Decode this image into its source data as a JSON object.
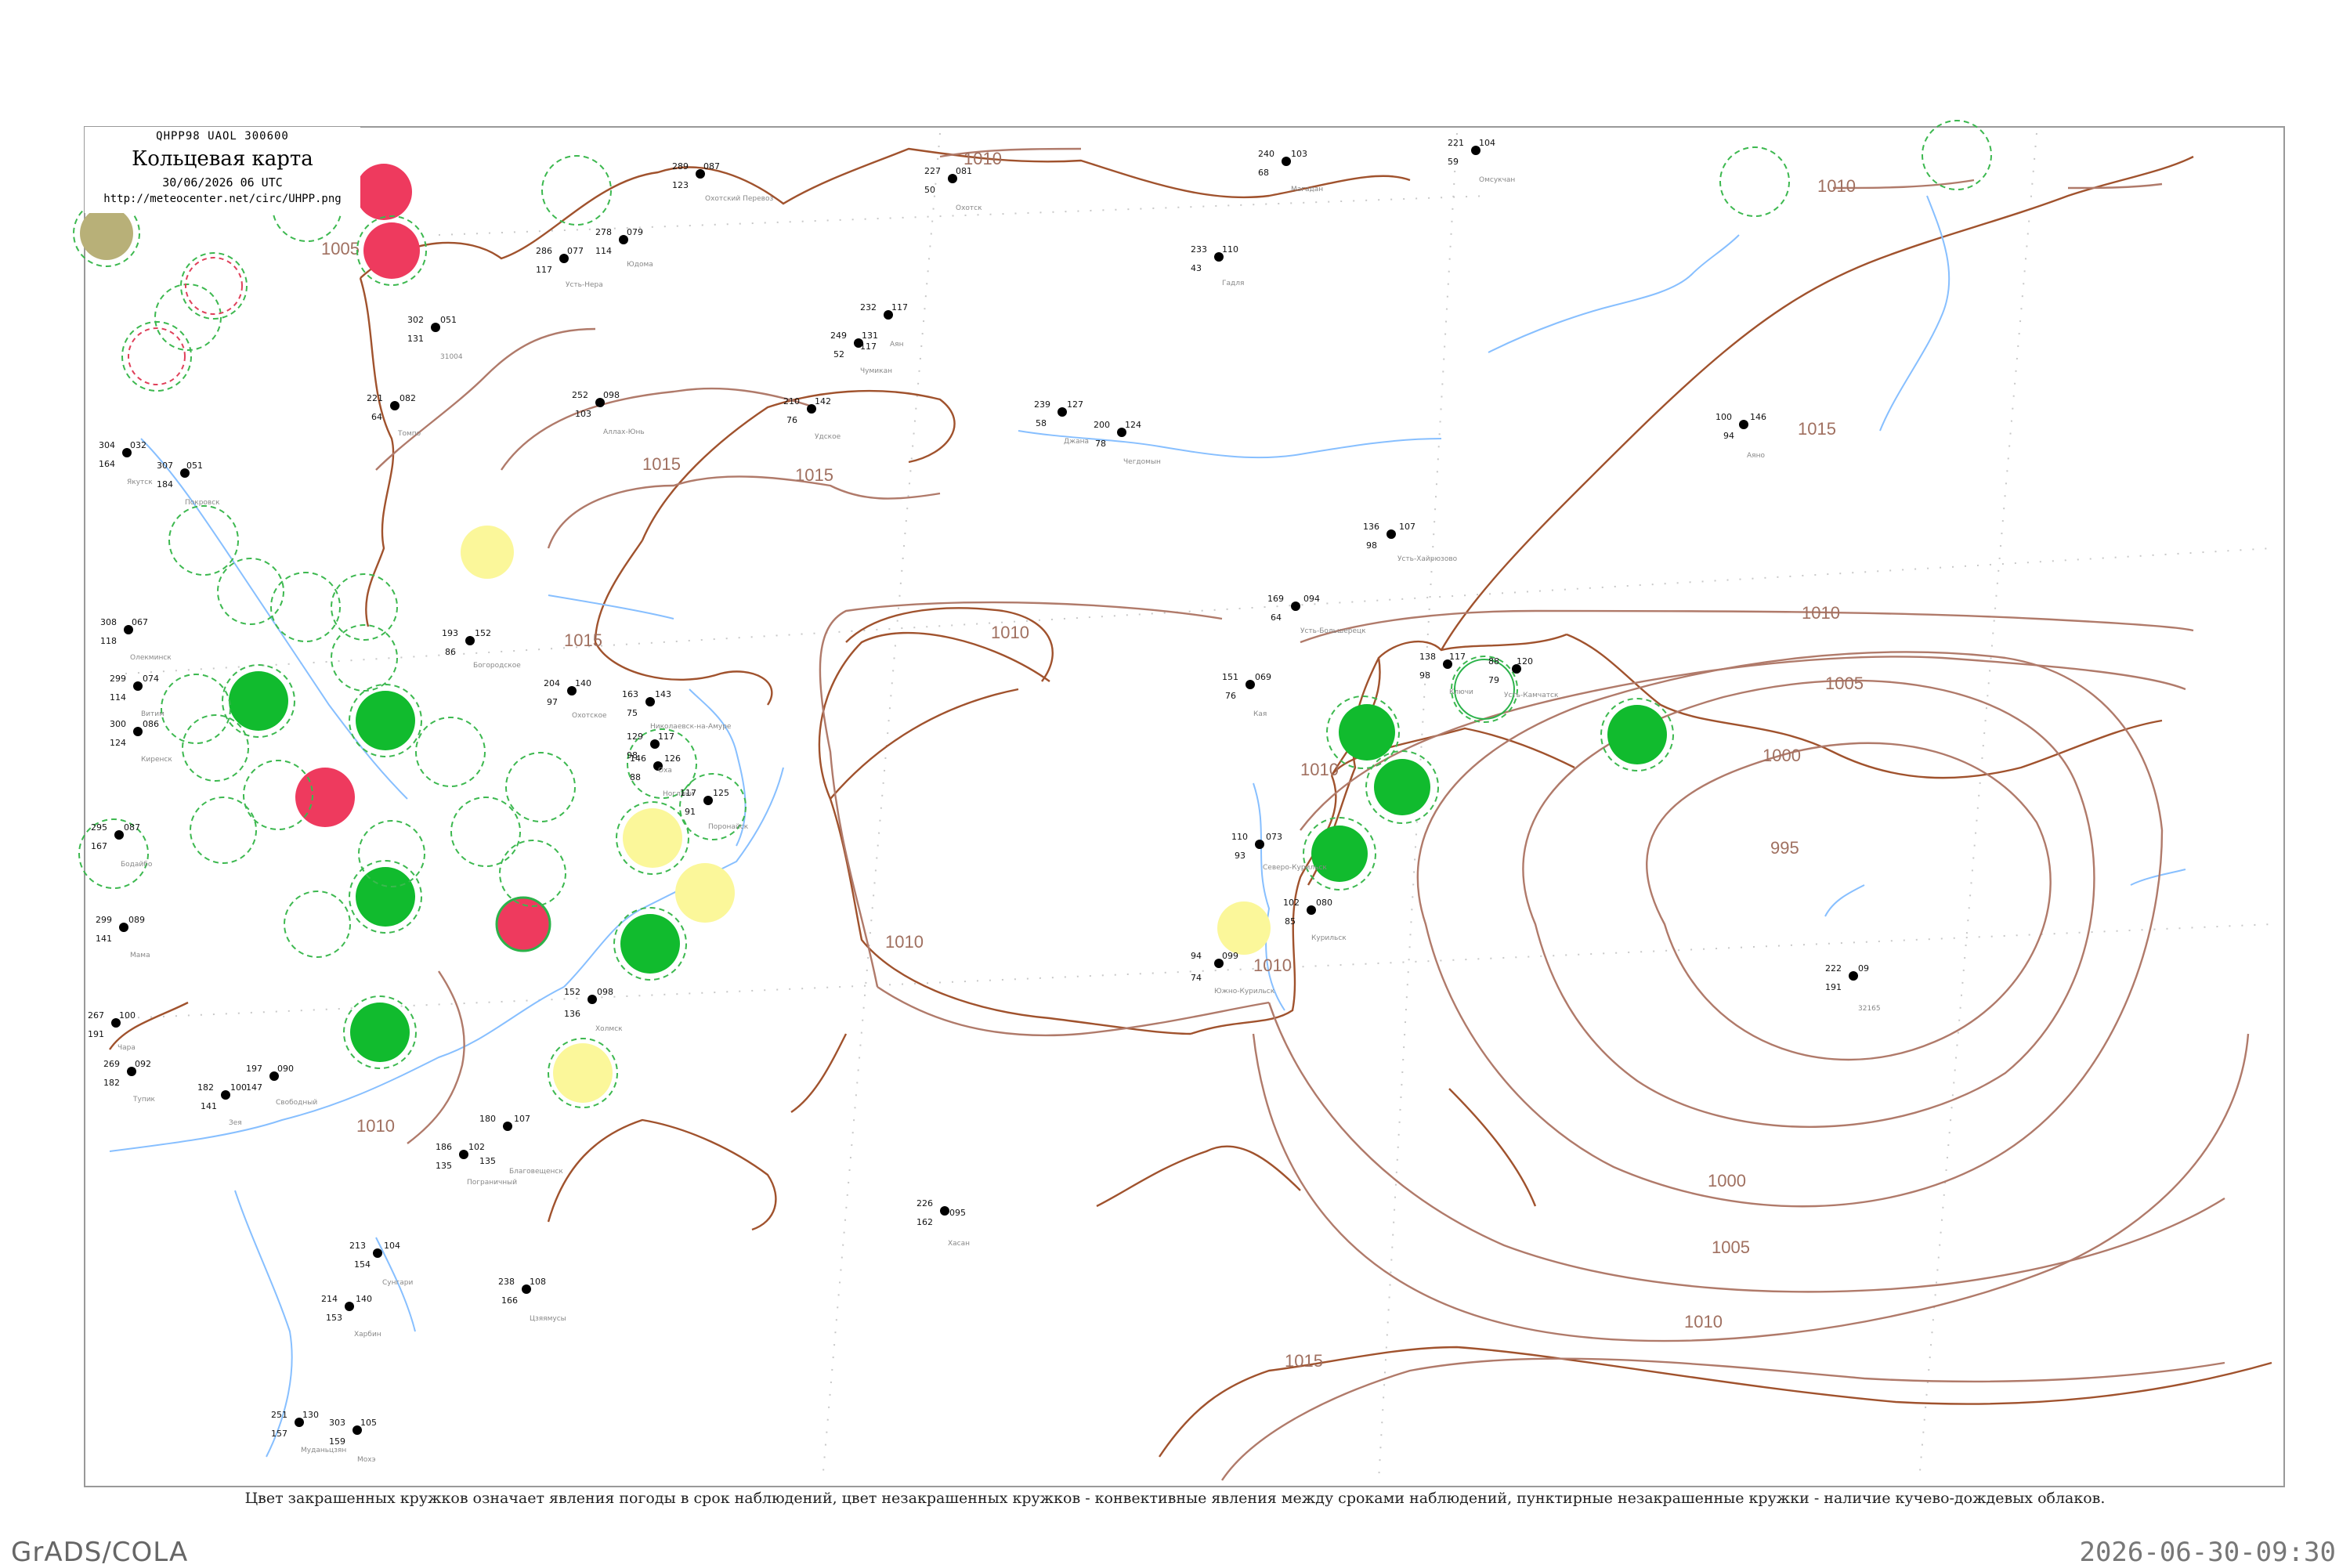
{
  "header": {
    "code": "QHPP98  UAOL  300600",
    "title": "Кольцевая карта",
    "time": "30/06/2026 06 UTC",
    "url": "http://meteocenter.net/circ/UHPP.png"
  },
  "legend": "Цвет закрашенных кружков означает явления погоды в срок наблюдений, цвет незакрашенных кружков - конвективные явления между сроками наблюдений, пунктирные незакрашенные кружки - наличие кучево-дождевых облаков.",
  "footer": {
    "left": "GrADS/COLA",
    "right": "2026-06-30-09:30"
  },
  "colors": {
    "coast": "#a0522d",
    "river": "#87bfff",
    "isobar": "#b07a6a",
    "green": "#11bb2e",
    "red": "#ee3a5e",
    "yellow": "#fbf79a",
    "olive": "#b8b078"
  },
  "isobar_labels": [
    "1010",
    "1015",
    "1010",
    "1015",
    "1010",
    "1005",
    "1000",
    "995",
    "1000",
    "1005",
    "1010",
    "1015",
    "1010",
    "1015",
    "1010",
    "1010",
    "1010",
    "1005",
    "1010",
    "1015"
  ],
  "stations": [
    {
      "t": "302",
      "td": "131",
      "p": "051",
      "name": "31004"
    },
    {
      "t": "286",
      "td": "117",
      "p": "077",
      "name": "Усть-Нера"
    },
    {
      "t": "278",
      "td": "114",
      "p": "079",
      "name": "Юдома"
    },
    {
      "t": "289",
      "td": "123",
      "p": "087",
      "name": "Охотский Перевоз"
    },
    {
      "t": "227",
      "td": "50",
      "p": "081",
      "name": "Охотск"
    },
    {
      "t": "240",
      "td": "68",
      "p": "103",
      "name": "Магадан"
    },
    {
      "t": "221",
      "td": "59",
      "p": "104",
      "name": "Омсукчан"
    },
    {
      "t": "233",
      "td": "43",
      "p": "110",
      "name": "Гадля"
    },
    {
      "t": "232",
      "td": "131",
      "p": "117",
      "name": "Аян"
    },
    {
      "t": "249",
      "td": "52",
      "p": "117",
      "name": "Чумикан"
    },
    {
      "t": "210",
      "td": "76",
      "p": "142",
      "name": "Удское"
    },
    {
      "t": "239",
      "td": "58",
      "p": "127",
      "name": "Джана"
    },
    {
      "t": "200",
      "td": "78",
      "p": "124",
      "name": "Чегдомын"
    },
    {
      "t": "100",
      "td": "94",
      "p": "146",
      "name": "Аяно"
    },
    {
      "t": "136",
      "td": "98",
      "p": "107",
      "name": "Усть-Хайрюзово"
    },
    {
      "t": "169",
      "td": "64",
      "p": "094",
      "name": "Усть-Большерецк"
    },
    {
      "t": "151",
      "td": "76",
      "p": "069",
      "name": "Кая"
    },
    {
      "t": "138",
      "td": "98",
      "p": "117",
      "name": "Ключи"
    },
    {
      "t": "88",
      "td": "79",
      "p": "120",
      "name": "Усть-Камчатск"
    },
    {
      "t": "110",
      "td": "93",
      "p": "073",
      "name": "Северо-Курильск"
    },
    {
      "t": "102",
      "td": "85",
      "p": "080",
      "name": "Курильск"
    },
    {
      "t": "94",
      "td": "74",
      "p": "099",
      "name": "Южно-Курильск"
    },
    {
      "t": "222",
      "td": "191",
      "p": "09",
      "name": "32165"
    },
    {
      "t": "226",
      "td": "162",
      "p": "095",
      "name": "Хасан"
    },
    {
      "t": "152",
      "td": "136",
      "p": "098",
      "name": "Холмск"
    },
    {
      "t": "163",
      "td": "75",
      "p": "143",
      "name": "Николаевск-на-Амуре"
    },
    {
      "t": "129",
      "td": "98",
      "p": "117",
      "name": "Оха"
    },
    {
      "t": "146",
      "td": "88",
      "p": "126",
      "name": "Ноглики"
    },
    {
      "t": "117",
      "td": "91",
      "p": "125",
      "name": "Поронайск"
    },
    {
      "t": "204",
      "td": "97",
      "p": "140",
      "name": "Охотское"
    },
    {
      "t": "193",
      "td": "86",
      "p": "152",
      "name": "Богородское"
    },
    {
      "t": "252",
      "td": "103",
      "p": "098",
      "name": "Аллах-Юнь"
    },
    {
      "t": "221",
      "td": "64",
      "p": "082",
      "name": "Томпо"
    },
    {
      "t": "304",
      "td": "164",
      "p": "032",
      "name": "Якутск"
    },
    {
      "t": "307",
      "td": "184",
      "p": "051",
      "name": "Покровск"
    },
    {
      "t": "308",
      "td": "118",
      "p": "067",
      "name": "Олекминск"
    },
    {
      "t": "299",
      "td": "114",
      "p": "074",
      "name": "Витим"
    },
    {
      "t": "300",
      "td": "124",
      "p": "086",
      "name": "Киренск"
    },
    {
      "t": "295",
      "td": "167",
      "p": "087",
      "name": "Бодайбо"
    },
    {
      "t": "299",
      "td": "141",
      "p": "089",
      "name": "Мама"
    },
    {
      "t": "267",
      "td": "191",
      "p": "100",
      "name": "Чара"
    },
    {
      "t": "269",
      "td": "182",
      "p": "092",
      "name": "Тупик"
    },
    {
      "t": "182",
      "td": "141",
      "p": "100",
      "name": "Зея"
    },
    {
      "t": "197",
      "td": "147",
      "p": "090",
      "name": "Свободный"
    },
    {
      "t": "180",
      "td": "135",
      "p": "107",
      "name": "Благовещенск"
    },
    {
      "t": "186",
      "td": "135",
      "p": "102",
      "name": "Пограничный"
    },
    {
      "t": "213",
      "td": "154",
      "p": "104",
      "name": "Сунгари"
    },
    {
      "t": "214",
      "td": "153",
      "p": "140",
      "name": "Харбин"
    },
    {
      "t": "251",
      "td": "157",
      "p": "130",
      "name": "Муданьцзян"
    },
    {
      "t": "303",
      "td": "159",
      "p": "105",
      "name": "Мохэ"
    },
    {
      "t": "238",
      "td": "166",
      "p": "108",
      "name": "Цзяямусы"
    }
  ]
}
